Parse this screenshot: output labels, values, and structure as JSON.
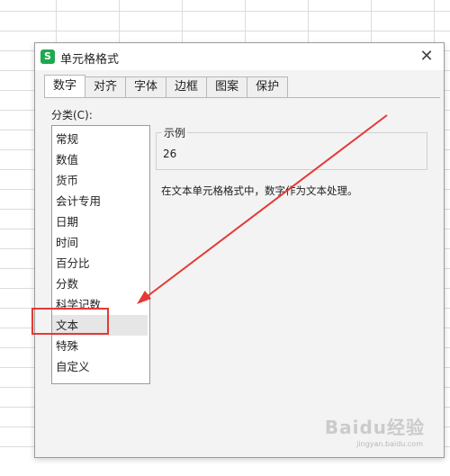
{
  "dialog": {
    "title": "单元格格式",
    "app_icon_glyph": "S"
  },
  "tabs": [
    {
      "label": "数字",
      "active": true
    },
    {
      "label": "对齐"
    },
    {
      "label": "字体"
    },
    {
      "label": "边框"
    },
    {
      "label": "图案"
    },
    {
      "label": "保护"
    }
  ],
  "category": {
    "label": "分类(C):",
    "items": [
      {
        "label": "常规"
      },
      {
        "label": "数值"
      },
      {
        "label": "货币"
      },
      {
        "label": "会计专用"
      },
      {
        "label": "日期"
      },
      {
        "label": "时间"
      },
      {
        "label": "百分比"
      },
      {
        "label": "分数"
      },
      {
        "label": "科学记数"
      },
      {
        "label": "文本",
        "selected": true
      },
      {
        "label": "特殊"
      },
      {
        "label": "自定义"
      }
    ]
  },
  "sample": {
    "legend": "示例",
    "value": "26"
  },
  "description": "在文本单元格格式中，数字作为文本处理。",
  "annotation_colors": {
    "highlight": "#e53935",
    "app_icon": "#1fa84f"
  },
  "watermark": {
    "main": "Baidu经验",
    "sub": "jingyan.baidu.com"
  }
}
